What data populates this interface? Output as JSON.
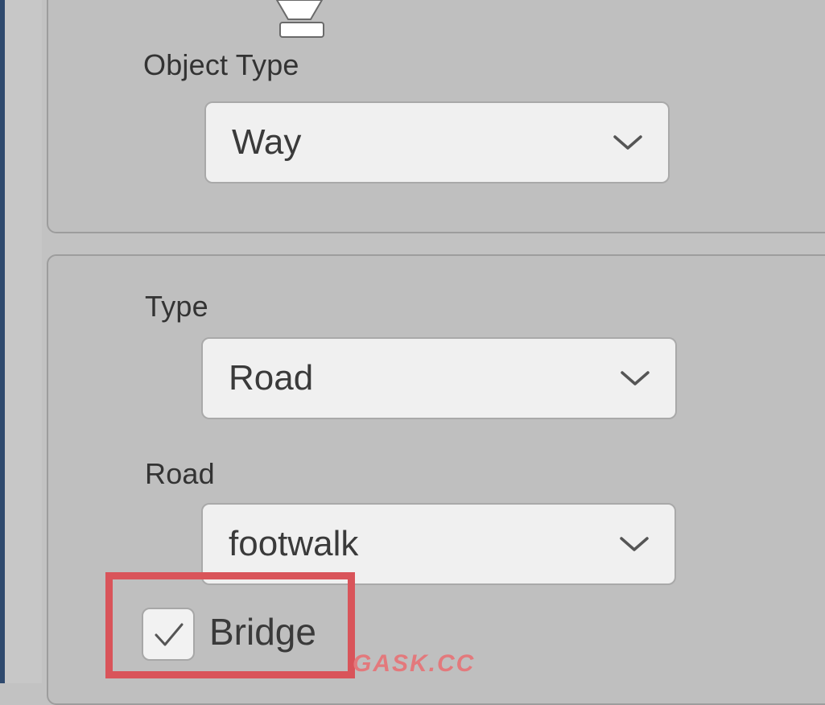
{
  "object_type": {
    "label": "Object Type",
    "selected": "Way"
  },
  "type": {
    "label": "Type",
    "selected": "Road"
  },
  "road": {
    "label": "Road",
    "selected": "footwalk"
  },
  "bridge": {
    "label": "Bridge",
    "checked": true
  },
  "icons": {
    "handle": "pin-handle-icon",
    "chevron": "chevron-down-icon",
    "check": "checkmark-icon"
  },
  "colors": {
    "highlight": "#d9545a",
    "panel": "#bfbfbf",
    "field": "#f0f0f0"
  },
  "watermark": "GASK.CC"
}
